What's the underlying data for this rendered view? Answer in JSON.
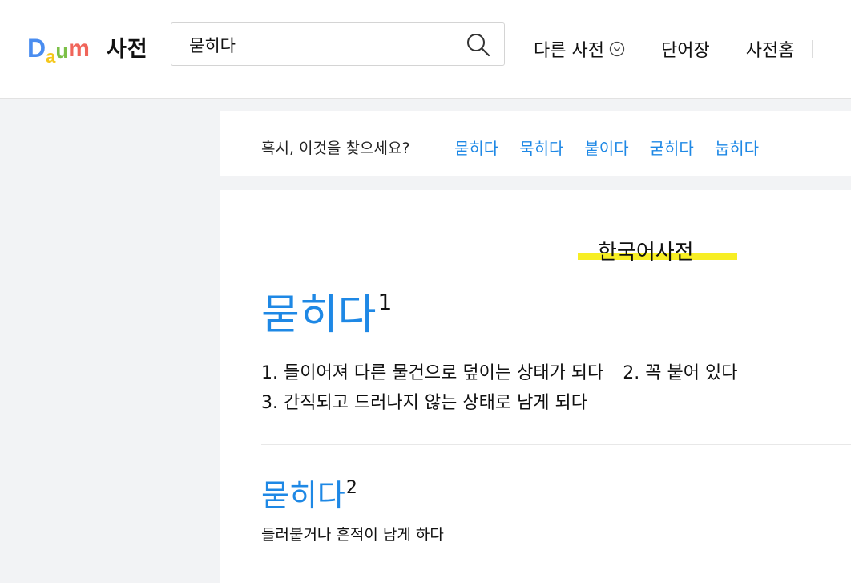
{
  "header": {
    "logo_letters": [
      "D",
      "a",
      "u",
      "m"
    ],
    "logo_colors": [
      "#4a8df0",
      "#f5c71a",
      "#7cc047",
      "#f0655a"
    ],
    "service_name": "사전",
    "search": {
      "value": "묻히다",
      "icon": "search-icon"
    },
    "nav": [
      {
        "label": "다른 사전",
        "icon": "chevron-down-circle-icon"
      },
      {
        "label": "단어장"
      },
      {
        "label": "사전홈"
      }
    ]
  },
  "suggest": {
    "label": "혹시, 이것을 찾으세요?",
    "links": [
      "묻히다",
      "묵히다",
      "붙이다",
      "굳히다",
      "눕히다"
    ]
  },
  "content": {
    "dict_title": "한국어사전",
    "highlight_color": "#f7ee24",
    "accent_color": "#1e88e5",
    "entries": [
      {
        "word": "묻히다",
        "sup": "1",
        "defs": [
          "1. 들이어져 다른 물건으로 덮이는 상태가 되다",
          "2. 꼭 붙어 있다",
          "3. 간직되고 드러나지 않는 상태로 남게 되다"
        ]
      },
      {
        "word": "묻히다",
        "sup": "2",
        "defs": [
          "들러붙거나 흔적이 남게 하다"
        ]
      }
    ]
  }
}
